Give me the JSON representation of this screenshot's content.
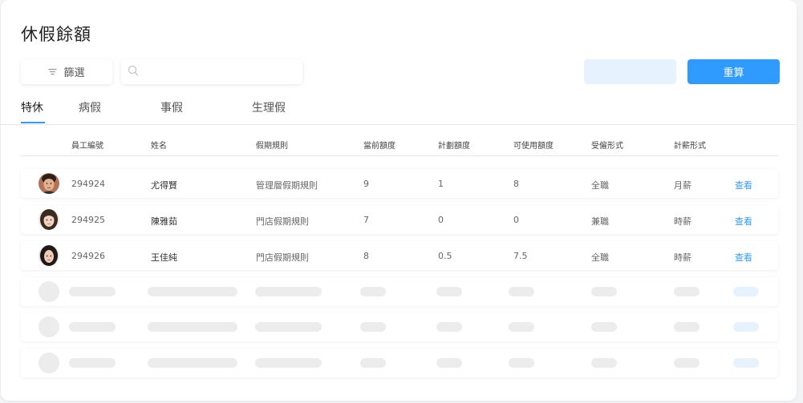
{
  "page": {
    "title": "休假餘額"
  },
  "toolbar": {
    "filter_label": "篩選",
    "filter_icon": "filter-icon",
    "search_icon": "search-icon",
    "search_value": "",
    "search_placeholder": "",
    "secondary_label": "",
    "recalc_label": "重算"
  },
  "tabs": [
    {
      "label": "特休",
      "active": true
    },
    {
      "label": "病假",
      "active": false
    },
    {
      "label": "事假",
      "active": false
    },
    {
      "label": "生理假",
      "active": false
    }
  ],
  "table": {
    "columns": [
      "員工編號",
      "姓名",
      "假期規則",
      "當前額度",
      "計劃額度",
      "可使用額度",
      "受僱形式",
      "計薪形式"
    ],
    "rows": [
      {
        "id": "294924",
        "name": "尤得賢",
        "rule": "管理層假期規則",
        "current": "9",
        "planned": "1",
        "available": "8",
        "employment": "全職",
        "pay": "月薪",
        "action": "查看"
      },
      {
        "id": "294925",
        "name": "陳雅茹",
        "rule": "門店假期規則",
        "current": "7",
        "planned": "0",
        "available": "0",
        "employment": "兼職",
        "pay": "時薪",
        "action": "查看"
      },
      {
        "id": "294926",
        "name": "王佳純",
        "rule": "門店假期規則",
        "current": "8",
        "planned": "0.5",
        "available": "7.5",
        "employment": "全職",
        "pay": "時薪",
        "action": "查看"
      }
    ],
    "skeleton_rows": 3
  },
  "colors": {
    "accent": "#2f9bff",
    "accent_light": "#e6f2fd",
    "skeleton": "#ececec"
  }
}
